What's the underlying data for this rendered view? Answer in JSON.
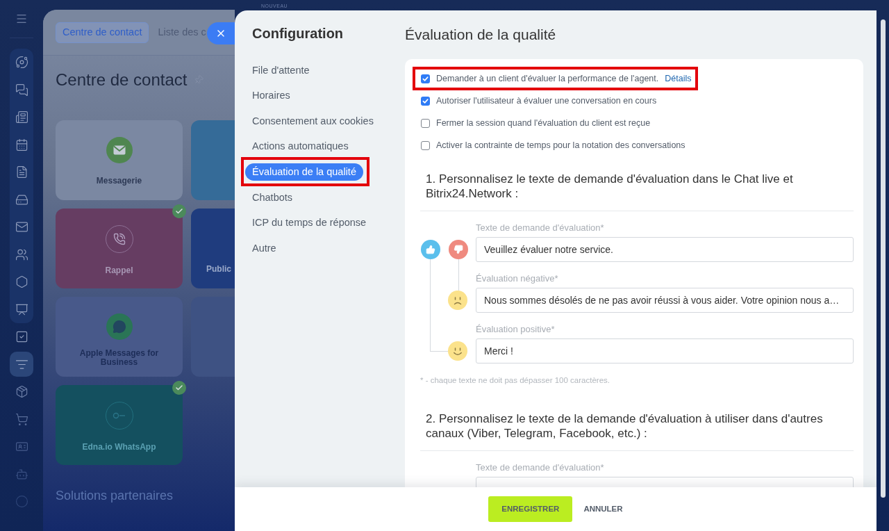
{
  "app_sidebar": {
    "pinned": [
      {
        "selected": false
      },
      {
        "selected": false
      },
      {
        "selected": false
      },
      {
        "selected": false
      },
      {
        "selected": false
      },
      {
        "selected": false
      },
      {
        "selected": false
      },
      {
        "selected": false
      },
      {
        "selected": false
      },
      {
        "selected": false
      }
    ],
    "more": [
      {
        "selected": false
      },
      {
        "selected": true
      },
      {
        "selected": false
      },
      {
        "selected": false
      },
      {
        "selected": false
      },
      {
        "selected": false
      },
      {
        "selected": false
      }
    ]
  },
  "background_page": {
    "tabs": [
      {
        "label": "Centre de contact",
        "selected": true
      },
      {
        "label": "Liste des c",
        "selected": false
      }
    ],
    "title": "Centre de contact",
    "tiles": [
      {
        "kind": "mail",
        "label": "Messagerie",
        "color": "#7b88a2",
        "connected": false
      },
      {
        "kind": "plain",
        "color": "#356b98",
        "connected": false
      },
      {
        "kind": "phone",
        "label": "Rappel",
        "color": "#663d62",
        "connected": true
      },
      {
        "kind": "plain",
        "label": "Public",
        "color": "#1f3c7e",
        "connected": false
      },
      {
        "kind": "chat",
        "label": "Apple Messages for Business",
        "color": "#48598a",
        "connected": false
      },
      {
        "kind": "plain",
        "color": "#3e5283",
        "connected": false
      },
      {
        "kind": "logo",
        "label": "Edna.io WhatsApp",
        "color": "#14505f",
        "connected": true
      }
    ],
    "section_title": "Solutions partenaires"
  },
  "new_label": "NOUVEAU",
  "settings_panel": {
    "nav": {
      "title": "Configuration",
      "items": [
        {
          "label": "File d'attente",
          "selected": false,
          "highlighted": false
        },
        {
          "label": "Horaires",
          "selected": false,
          "highlighted": false
        },
        {
          "label": "Consentement aux cookies",
          "selected": false,
          "highlighted": false
        },
        {
          "label": "Actions automatiques",
          "selected": false,
          "highlighted": false
        },
        {
          "label": "Évaluation de la qualité",
          "selected": true,
          "highlighted": true
        },
        {
          "label": "Chatbots",
          "selected": false,
          "highlighted": false
        },
        {
          "label": "ICP du temps de réponse",
          "selected": false,
          "highlighted": false
        },
        {
          "label": "Autre",
          "selected": false,
          "highlighted": false
        }
      ]
    },
    "title": "Évaluation de la qualité",
    "options": [
      {
        "label": "Demander à un client d'évaluer la performance de l'agent.",
        "link": "Détails",
        "checked": true,
        "highlighted": true
      },
      {
        "label": "Autoriser l'utilisateur à évaluer une conversation en cours",
        "checked": true,
        "highlighted": false
      },
      {
        "label": "Fermer la session quand l'évaluation du client est reçue",
        "checked": false,
        "highlighted": false
      },
      {
        "label": "Activer la contrainte de temps pour la notation des conversations",
        "checked": false,
        "highlighted": false
      }
    ],
    "sections": [
      {
        "heading": "1. Personnalisez le texte de demande d'évaluation dans le Chat live et Bitrix24.Network :",
        "fields": [
          {
            "kind": "request",
            "label": "Texte de demande d'évaluation*",
            "value": "Veuillez évaluer notre service."
          },
          {
            "kind": "negative",
            "label": "Évaluation négative*",
            "value": "Nous sommes désolés de ne pas avoir réussi à vous aider. Votre opinion nous a…"
          },
          {
            "kind": "positive",
            "label": "Évaluation positive*",
            "value": "Merci !"
          }
        ],
        "note": "* - chaque texte ne doit pas dépasser 100 caractères."
      },
      {
        "heading": "2. Personnalisez le texte de la demande d'évaluation à utiliser dans d'autres canaux (Viber, Telegram, Facebook, etc.) :",
        "fields": [
          {
            "kind": "plain",
            "label": "Texte de demande d'évaluation*"
          }
        ]
      }
    ],
    "footer": {
      "buttons": [
        {
          "kind": "primary",
          "label": "ENREGISTRER"
        },
        {
          "kind": "link",
          "label": "ANNULER"
        }
      ]
    }
  }
}
